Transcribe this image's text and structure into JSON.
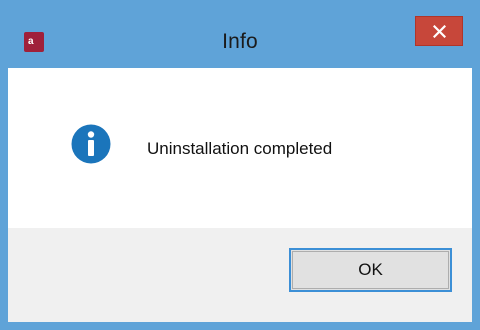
{
  "window": {
    "title": "Info",
    "close_icon": "close-icon",
    "app_icon": "app-icon"
  },
  "dialog": {
    "message": "Uninstallation completed",
    "icon": "info-icon",
    "ok_label": "OK"
  },
  "colors": {
    "frame": "#5fa3d8",
    "close_button": "#c7473a",
    "info_icon": "#1b75bb",
    "footer": "#f0f0f0",
    "ok_border": "#3c8fd6"
  }
}
